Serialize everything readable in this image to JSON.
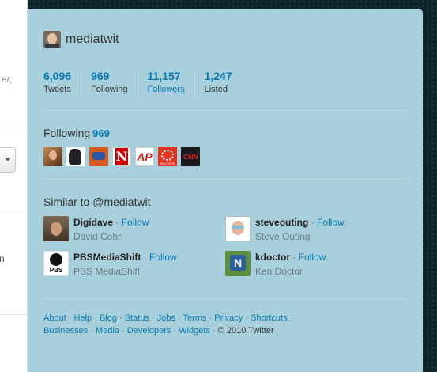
{
  "left_fragments": {
    "text1": "er,",
    "text2": "n"
  },
  "profile": {
    "screen_name": "mediatwit"
  },
  "stats": [
    {
      "value": "6,096",
      "label": "Tweets"
    },
    {
      "value": "969",
      "label": "Following"
    },
    {
      "value": "11,157",
      "label": "Followers"
    },
    {
      "value": "1,247",
      "label": "Listed"
    }
  ],
  "following": {
    "heading": "Following",
    "count": "969",
    "avatars": [
      {
        "icon": "person-avatar-icon"
      },
      {
        "icon": "silhouette-avatar-icon"
      },
      {
        "icon": "logo-avatar-icon"
      },
      {
        "icon": "newsweek-logo-icon",
        "glyph": "N"
      },
      {
        "icon": "ap-logo-icon",
        "glyph": "AP"
      },
      {
        "icon": "reuters-logo-icon",
        "glyph": "REUTERS"
      },
      {
        "icon": "cnn-logo-icon",
        "glyph": "CNN"
      }
    ]
  },
  "similar": {
    "heading": "Similar to @mediatwit",
    "items": [
      {
        "name": "Digidave",
        "sep": " · ",
        "follow": "Follow",
        "full_name": "David Cohn"
      },
      {
        "name": "steveouting",
        "sep": " · ",
        "follow": "Follow",
        "full_name": "Steve Outing"
      },
      {
        "name": "PBSMediaShift",
        "sep": " · ",
        "follow": "Follow",
        "full_name": "PBS MediaShift",
        "glyph": "PBS"
      },
      {
        "name": "kdoctor",
        "sep": " · ",
        "follow": "Follow",
        "full_name": "Ken Doctor",
        "glyph": "N"
      }
    ]
  },
  "footer": {
    "row1": [
      "About",
      "Help",
      "Blog",
      "Status",
      "Jobs",
      "Terms",
      "Privacy",
      "Shortcuts"
    ],
    "row2": [
      "Businesses",
      "Media",
      "Developers",
      "Widgets"
    ],
    "copyright": "© 2010 Twitter",
    "sep": " · "
  },
  "colors": {
    "panel": "#a8cfdc",
    "link": "#0a7bb0",
    "background": "#0d2327"
  }
}
